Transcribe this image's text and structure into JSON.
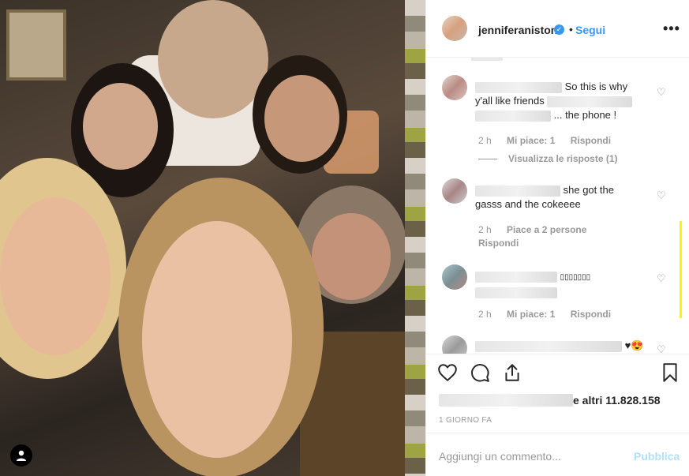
{
  "post": {
    "username": "jenniferaniston",
    "follow_label": "Segui",
    "separator": "•",
    "more_label": "•••"
  },
  "comments": [
    {
      "text_a": "So this is why",
      "text_b": "y'all like friends",
      "text_c": "... the phone ! ",
      "time": "2 h",
      "likes": "Mi piace: 1",
      "reply": "Rispondi",
      "view_replies": "Visualizza le risposte (1)"
    },
    {
      "text_a": "she got the",
      "text_b": "gasss and the cokeeee",
      "time": "2 h",
      "likes": "Piace a 2 persone",
      "reply": "Rispondi"
    },
    {
      "text_a": "",
      "time": "2 h",
      "likes": "Mi piace: 1",
      "reply": "Rispondi"
    },
    {
      "text_a": "♥😍"
    }
  ],
  "footer": {
    "likes_suffix": "e altri 11.828.158",
    "time_ago": "1 GIORNO FA",
    "comment_placeholder": "Aggiungi un commento...",
    "post_label": "Pubblica"
  },
  "icons": {
    "heart": "heart-icon",
    "comment": "comment-icon",
    "share": "share-icon",
    "bookmark": "bookmark-icon",
    "user_tag": "user-icon",
    "verified": "verified-badge-icon"
  },
  "colors": {
    "link_blue": "#3897f0",
    "post_disabled": "#b2dffc",
    "scroll_highlight": "#f7f702"
  }
}
